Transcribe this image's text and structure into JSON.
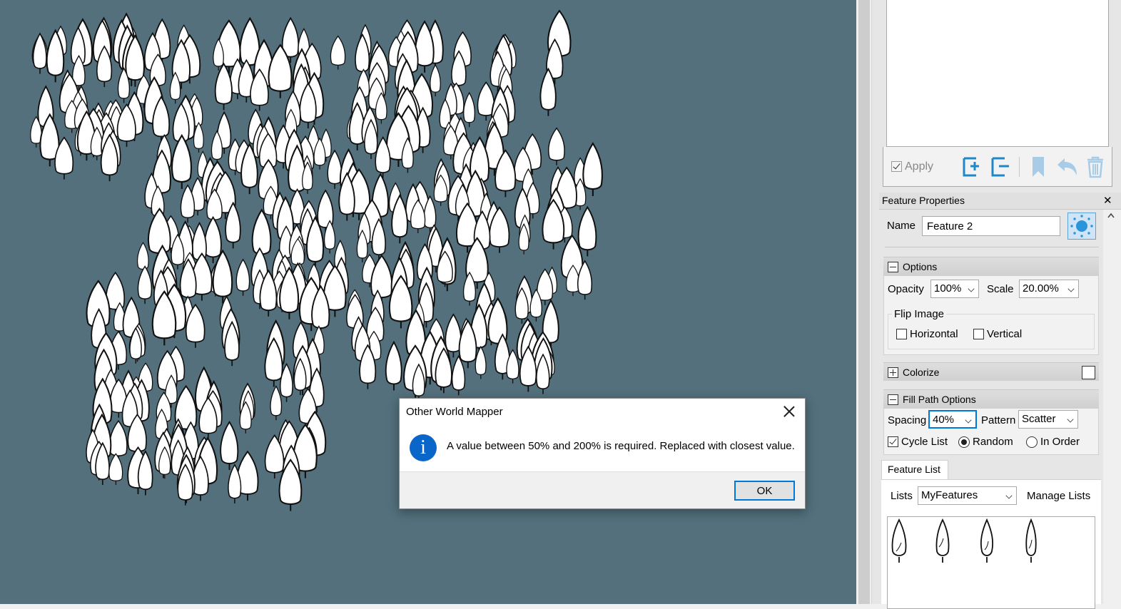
{
  "app": {
    "accent_color": "#0078d7",
    "canvas_color": "#53707c",
    "icon_color": "#1e88c8"
  },
  "history_panel": {
    "apply_label": "Apply",
    "apply_checked": true,
    "icons": [
      "add-feature-icon",
      "remove-feature-icon",
      "bookmark-icon",
      "undo-icon",
      "trash-icon"
    ]
  },
  "feature_properties": {
    "title": "Feature Properties",
    "close_glyph": "✕",
    "name_label": "Name",
    "name_value": "Feature 2",
    "options": {
      "title": "Options",
      "opacity_label": "Opacity",
      "opacity_value": "100%",
      "scale_label": "Scale",
      "scale_value": "20.00%",
      "flip_label": "Flip Image",
      "horizontal_label": "Horizontal",
      "vertical_label": "Vertical",
      "horizontal_checked": false,
      "vertical_checked": false
    },
    "colorize": {
      "title": "Colorize"
    },
    "fill_path": {
      "title": "Fill Path Options",
      "spacing_label": "Spacing",
      "spacing_value": "40%",
      "pattern_label": "Pattern",
      "pattern_value": "Scatter",
      "cycle_label": "Cycle List",
      "cycle_checked": true,
      "random_label": "Random",
      "inorder_label": "In Order",
      "selected_order": "Random"
    }
  },
  "feature_list": {
    "tab_label": "Feature List",
    "lists_label": "Lists",
    "lists_value": "MyFeatures",
    "manage_label": "Manage Lists",
    "items": [
      "tree-1-icon",
      "tree-2-icon",
      "tree-3-icon",
      "tree-4-icon"
    ]
  },
  "dialog": {
    "title": "Other World Mapper",
    "message": "A value between 50% and 200% is required. Replaced with closest value.",
    "ok_label": "OK",
    "icon_glyph": "i"
  }
}
